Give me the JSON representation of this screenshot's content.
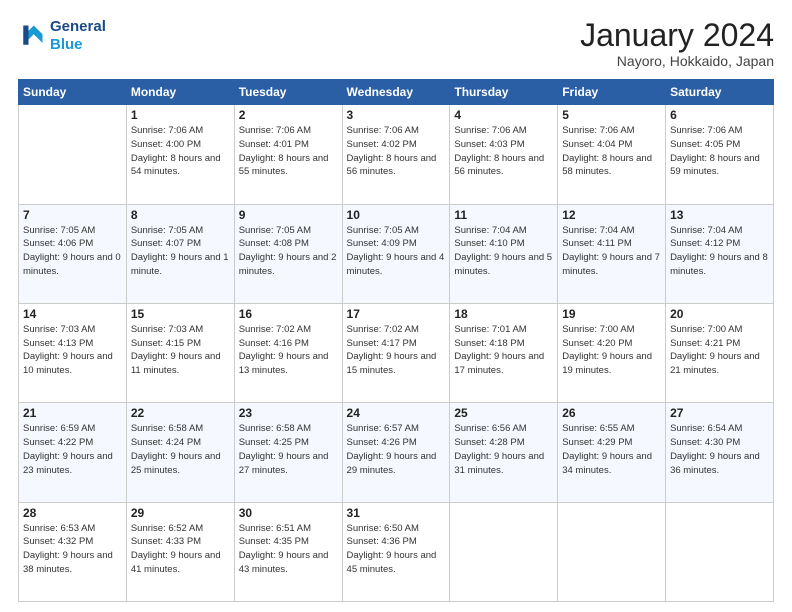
{
  "header": {
    "logo_line1": "General",
    "logo_line2": "Blue",
    "month": "January 2024",
    "location": "Nayoro, Hokkaido, Japan"
  },
  "weekdays": [
    "Sunday",
    "Monday",
    "Tuesday",
    "Wednesday",
    "Thursday",
    "Friday",
    "Saturday"
  ],
  "weeks": [
    [
      {
        "day": "",
        "sunrise": "",
        "sunset": "",
        "daylight": ""
      },
      {
        "day": "1",
        "sunrise": "Sunrise: 7:06 AM",
        "sunset": "Sunset: 4:00 PM",
        "daylight": "Daylight: 8 hours and 54 minutes."
      },
      {
        "day": "2",
        "sunrise": "Sunrise: 7:06 AM",
        "sunset": "Sunset: 4:01 PM",
        "daylight": "Daylight: 8 hours and 55 minutes."
      },
      {
        "day": "3",
        "sunrise": "Sunrise: 7:06 AM",
        "sunset": "Sunset: 4:02 PM",
        "daylight": "Daylight: 8 hours and 56 minutes."
      },
      {
        "day": "4",
        "sunrise": "Sunrise: 7:06 AM",
        "sunset": "Sunset: 4:03 PM",
        "daylight": "Daylight: 8 hours and 56 minutes."
      },
      {
        "day": "5",
        "sunrise": "Sunrise: 7:06 AM",
        "sunset": "Sunset: 4:04 PM",
        "daylight": "Daylight: 8 hours and 58 minutes."
      },
      {
        "day": "6",
        "sunrise": "Sunrise: 7:06 AM",
        "sunset": "Sunset: 4:05 PM",
        "daylight": "Daylight: 8 hours and 59 minutes."
      }
    ],
    [
      {
        "day": "7",
        "sunrise": "Sunrise: 7:05 AM",
        "sunset": "Sunset: 4:06 PM",
        "daylight": "Daylight: 9 hours and 0 minutes."
      },
      {
        "day": "8",
        "sunrise": "Sunrise: 7:05 AM",
        "sunset": "Sunset: 4:07 PM",
        "daylight": "Daylight: 9 hours and 1 minute."
      },
      {
        "day": "9",
        "sunrise": "Sunrise: 7:05 AM",
        "sunset": "Sunset: 4:08 PM",
        "daylight": "Daylight: 9 hours and 2 minutes."
      },
      {
        "day": "10",
        "sunrise": "Sunrise: 7:05 AM",
        "sunset": "Sunset: 4:09 PM",
        "daylight": "Daylight: 9 hours and 4 minutes."
      },
      {
        "day": "11",
        "sunrise": "Sunrise: 7:04 AM",
        "sunset": "Sunset: 4:10 PM",
        "daylight": "Daylight: 9 hours and 5 minutes."
      },
      {
        "day": "12",
        "sunrise": "Sunrise: 7:04 AM",
        "sunset": "Sunset: 4:11 PM",
        "daylight": "Daylight: 9 hours and 7 minutes."
      },
      {
        "day": "13",
        "sunrise": "Sunrise: 7:04 AM",
        "sunset": "Sunset: 4:12 PM",
        "daylight": "Daylight: 9 hours and 8 minutes."
      }
    ],
    [
      {
        "day": "14",
        "sunrise": "Sunrise: 7:03 AM",
        "sunset": "Sunset: 4:13 PM",
        "daylight": "Daylight: 9 hours and 10 minutes."
      },
      {
        "day": "15",
        "sunrise": "Sunrise: 7:03 AM",
        "sunset": "Sunset: 4:15 PM",
        "daylight": "Daylight: 9 hours and 11 minutes."
      },
      {
        "day": "16",
        "sunrise": "Sunrise: 7:02 AM",
        "sunset": "Sunset: 4:16 PM",
        "daylight": "Daylight: 9 hours and 13 minutes."
      },
      {
        "day": "17",
        "sunrise": "Sunrise: 7:02 AM",
        "sunset": "Sunset: 4:17 PM",
        "daylight": "Daylight: 9 hours and 15 minutes."
      },
      {
        "day": "18",
        "sunrise": "Sunrise: 7:01 AM",
        "sunset": "Sunset: 4:18 PM",
        "daylight": "Daylight: 9 hours and 17 minutes."
      },
      {
        "day": "19",
        "sunrise": "Sunrise: 7:00 AM",
        "sunset": "Sunset: 4:20 PM",
        "daylight": "Daylight: 9 hours and 19 minutes."
      },
      {
        "day": "20",
        "sunrise": "Sunrise: 7:00 AM",
        "sunset": "Sunset: 4:21 PM",
        "daylight": "Daylight: 9 hours and 21 minutes."
      }
    ],
    [
      {
        "day": "21",
        "sunrise": "Sunrise: 6:59 AM",
        "sunset": "Sunset: 4:22 PM",
        "daylight": "Daylight: 9 hours and 23 minutes."
      },
      {
        "day": "22",
        "sunrise": "Sunrise: 6:58 AM",
        "sunset": "Sunset: 4:24 PM",
        "daylight": "Daylight: 9 hours and 25 minutes."
      },
      {
        "day": "23",
        "sunrise": "Sunrise: 6:58 AM",
        "sunset": "Sunset: 4:25 PM",
        "daylight": "Daylight: 9 hours and 27 minutes."
      },
      {
        "day": "24",
        "sunrise": "Sunrise: 6:57 AM",
        "sunset": "Sunset: 4:26 PM",
        "daylight": "Daylight: 9 hours and 29 minutes."
      },
      {
        "day": "25",
        "sunrise": "Sunrise: 6:56 AM",
        "sunset": "Sunset: 4:28 PM",
        "daylight": "Daylight: 9 hours and 31 minutes."
      },
      {
        "day": "26",
        "sunrise": "Sunrise: 6:55 AM",
        "sunset": "Sunset: 4:29 PM",
        "daylight": "Daylight: 9 hours and 34 minutes."
      },
      {
        "day": "27",
        "sunrise": "Sunrise: 6:54 AM",
        "sunset": "Sunset: 4:30 PM",
        "daylight": "Daylight: 9 hours and 36 minutes."
      }
    ],
    [
      {
        "day": "28",
        "sunrise": "Sunrise: 6:53 AM",
        "sunset": "Sunset: 4:32 PM",
        "daylight": "Daylight: 9 hours and 38 minutes."
      },
      {
        "day": "29",
        "sunrise": "Sunrise: 6:52 AM",
        "sunset": "Sunset: 4:33 PM",
        "daylight": "Daylight: 9 hours and 41 minutes."
      },
      {
        "day": "30",
        "sunrise": "Sunrise: 6:51 AM",
        "sunset": "Sunset: 4:35 PM",
        "daylight": "Daylight: 9 hours and 43 minutes."
      },
      {
        "day": "31",
        "sunrise": "Sunrise: 6:50 AM",
        "sunset": "Sunset: 4:36 PM",
        "daylight": "Daylight: 9 hours and 45 minutes."
      },
      {
        "day": "",
        "sunrise": "",
        "sunset": "",
        "daylight": ""
      },
      {
        "day": "",
        "sunrise": "",
        "sunset": "",
        "daylight": ""
      },
      {
        "day": "",
        "sunrise": "",
        "sunset": "",
        "daylight": ""
      }
    ]
  ]
}
